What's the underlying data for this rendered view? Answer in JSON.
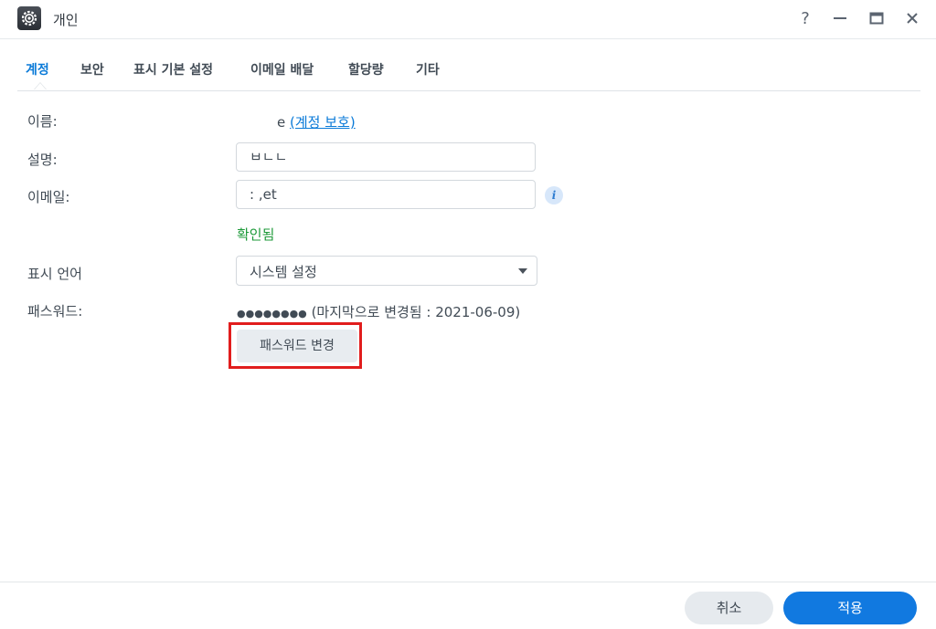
{
  "window": {
    "title": "개인",
    "help_label": "?",
    "minimize_label": "—",
    "maximize_label": "▭",
    "close_label": "✕",
    "app_icon": "gear-icon"
  },
  "tabs": [
    {
      "label": "계정",
      "active": true
    },
    {
      "label": "보안",
      "active": false
    },
    {
      "label": "표시 기본 설정",
      "active": false
    },
    {
      "label": "이메일 배달",
      "active": false
    },
    {
      "label": "할당량",
      "active": false
    },
    {
      "label": "기타",
      "active": false
    }
  ],
  "form": {
    "name_label": "이름:",
    "name_value": "e",
    "name_link": "(계정 보호)",
    "description_label": "설명:",
    "description_value": "ㅂㄴㄴ",
    "email_label": "이메일:",
    "email_value": ": ,et",
    "email_info_icon": "info-icon",
    "email_status": "확인됨",
    "language_label": "표시 언어",
    "language_value": "시스템 설정",
    "password_label": "패스워드:",
    "password_mask": "●●●●●●●●",
    "password_changed": "(마지막으로 변경됨 : 2021-06-09)",
    "change_password_button": "패스워드 변경"
  },
  "footer": {
    "cancel_label": "취소",
    "apply_label": "적용"
  },
  "colors": {
    "accent": "#1179e0",
    "verified": "#1e9a3a",
    "highlight": "#e11d1d"
  }
}
